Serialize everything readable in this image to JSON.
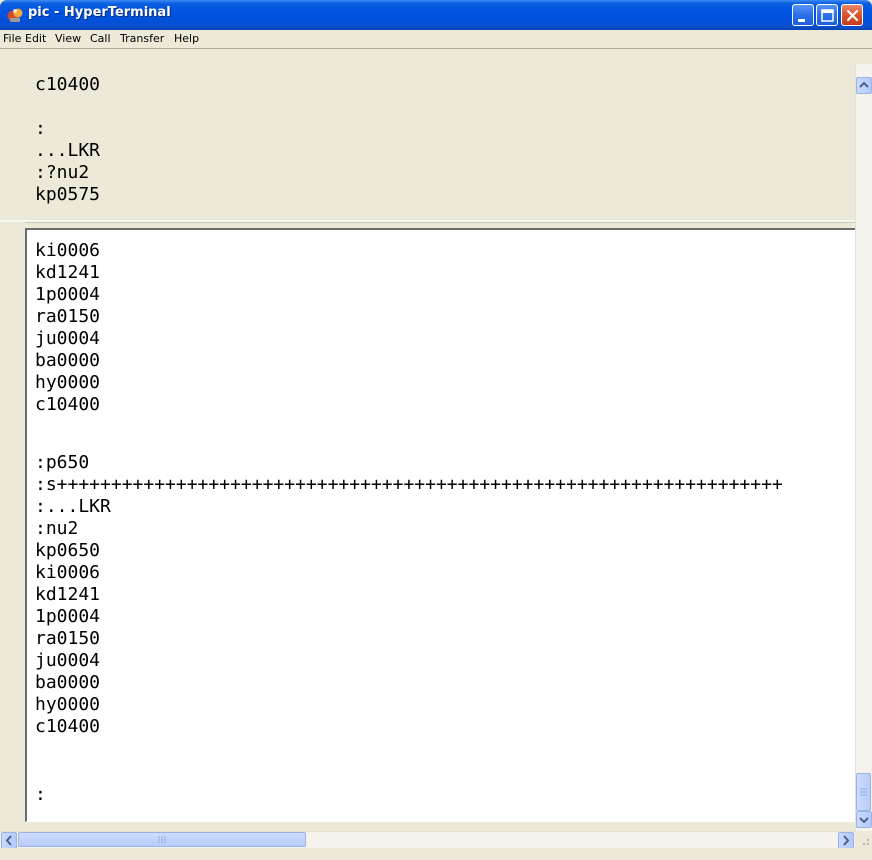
{
  "window": {
    "title": "pic - HyperTerminal"
  },
  "menu": [
    "File",
    "Edit",
    "View",
    "Call",
    "Transfer",
    "Help"
  ],
  "upper_pane": {
    "lines": [
      "c10400",
      "",
      ":",
      "...LKR",
      ":?nu2",
      "kp0575"
    ]
  },
  "lower_pane": {
    "lines": [
      "ki0006",
      "kd1241",
      "1p0004",
      "ra0150",
      "ju0004",
      "ba0000",
      "hy0000",
      "c10400",
      "",
      ":p650",
      ":s+++++++++++++++++++++++++++++++++++++++++++++++++++++++++++++++++++",
      ":...LKR",
      ":nu2",
      "kp0650",
      "ki0006",
      "kd1241",
      "1p0004",
      "ra0150",
      "ju0004",
      "ba0000",
      "hy0000",
      "c10400",
      "",
      ":"
    ]
  },
  "icons": {
    "app": "hyperterminal-icon",
    "minimize": "minimize-icon",
    "maximize": "maximize-icon",
    "close": "close-icon"
  }
}
